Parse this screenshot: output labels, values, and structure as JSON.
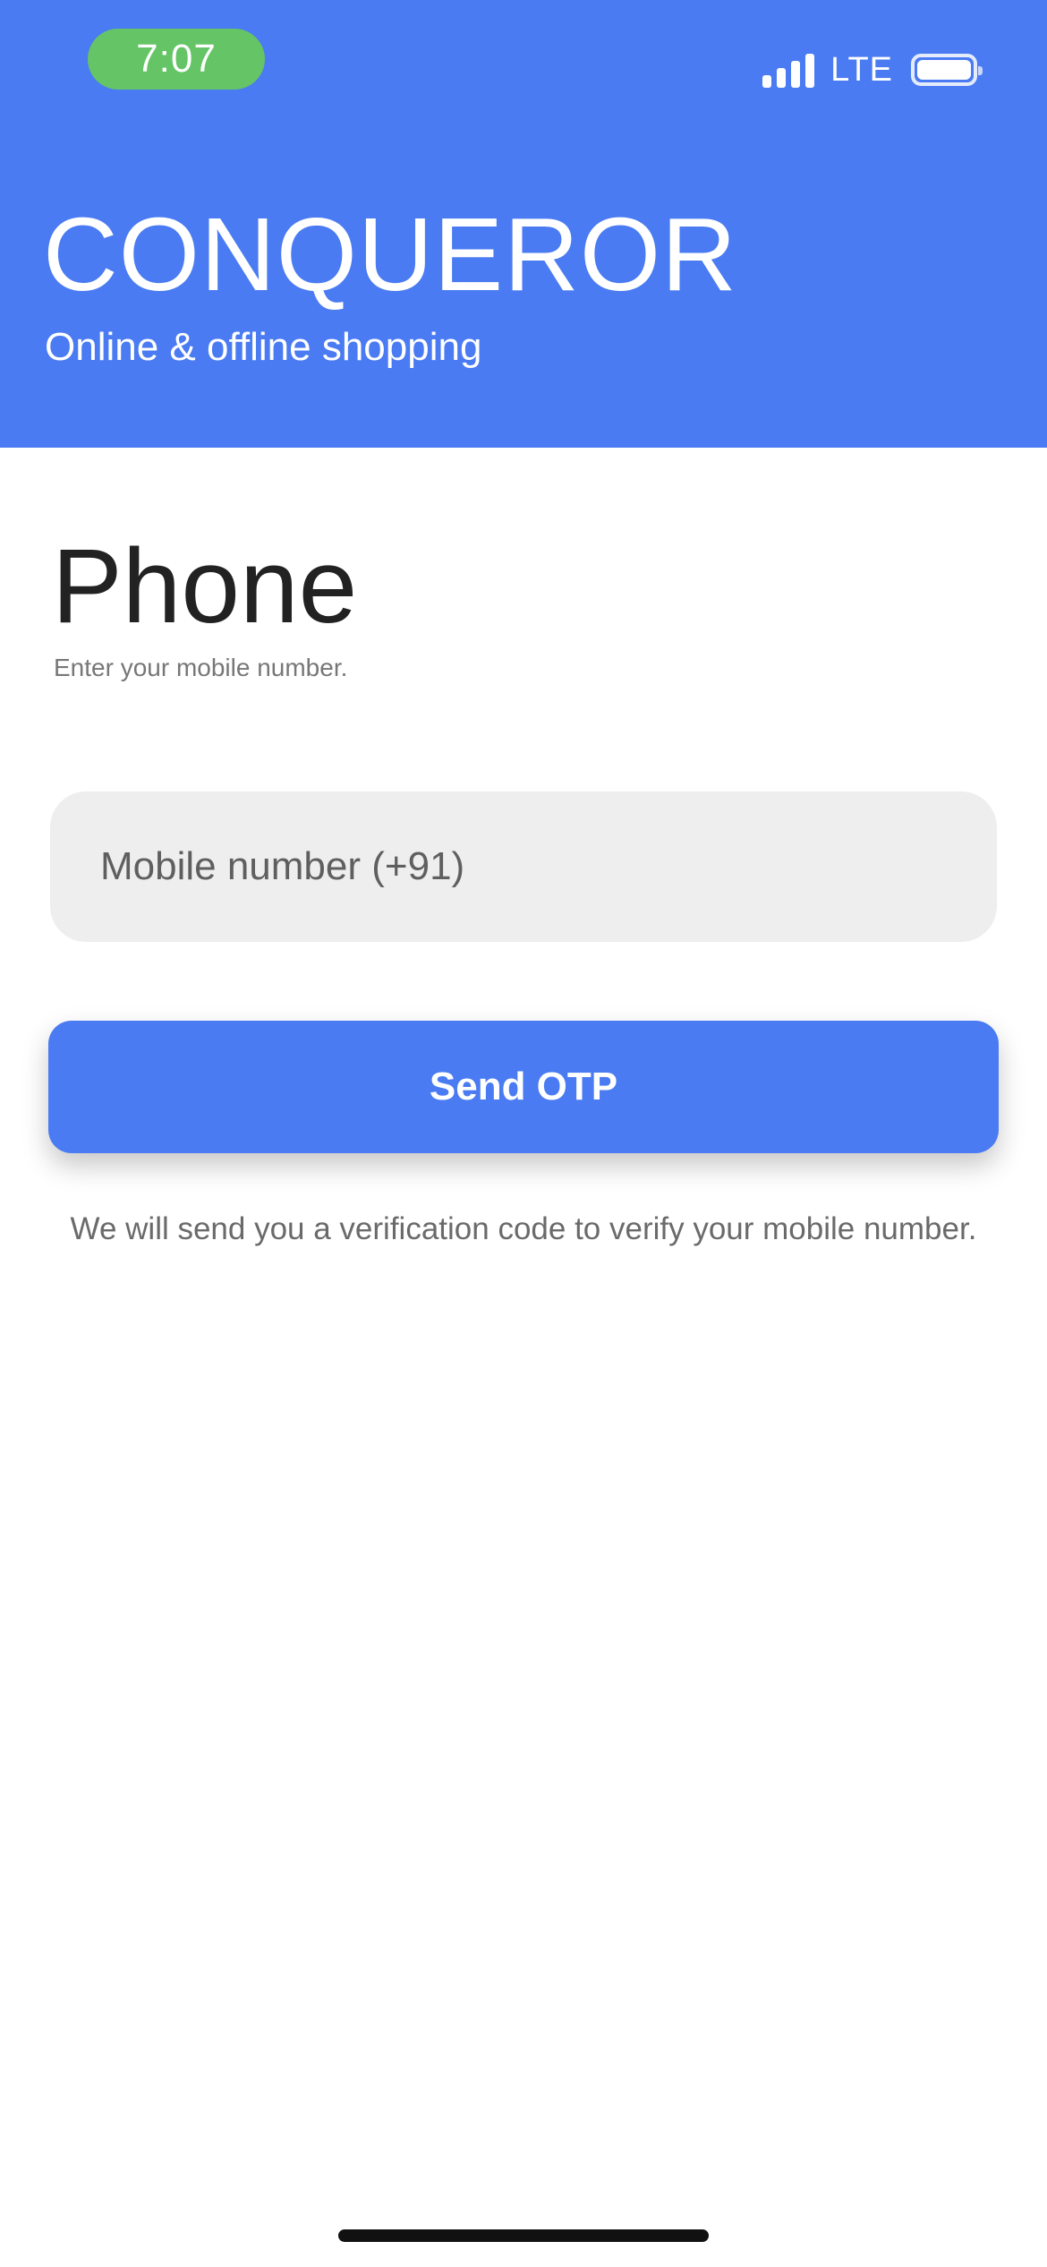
{
  "status_bar": {
    "time": "7:07",
    "network": "LTE",
    "icons": [
      "cellular-signal-icon",
      "battery-icon"
    ]
  },
  "header": {
    "brand_name": "CONQUEROR",
    "tagline": "Online & offline shopping"
  },
  "main": {
    "title": "Phone",
    "subtitle": "Enter your mobile number.",
    "mobile_input": {
      "placeholder": "Mobile number (+91)",
      "value": ""
    },
    "send_otp_label": "Send OTP",
    "helper_text": "We will send you a verification code to verify your mobile number."
  },
  "colors": {
    "accent": "#4a7bf2",
    "time_pill": "#65c466",
    "input_background": "#eeeeee",
    "title_text": "#222222",
    "secondary_text": "#777777"
  }
}
